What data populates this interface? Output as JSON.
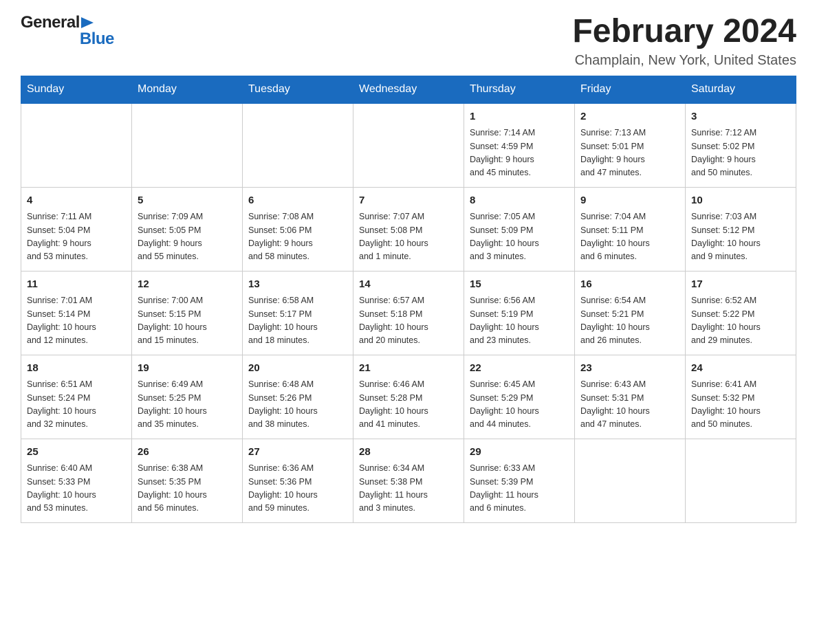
{
  "header": {
    "logo_general": "General",
    "logo_blue": "Blue",
    "month_title": "February 2024",
    "location": "Champlain, New York, United States"
  },
  "weekdays": [
    "Sunday",
    "Monday",
    "Tuesday",
    "Wednesday",
    "Thursday",
    "Friday",
    "Saturday"
  ],
  "weeks": [
    [
      {
        "day": "",
        "info": ""
      },
      {
        "day": "",
        "info": ""
      },
      {
        "day": "",
        "info": ""
      },
      {
        "day": "",
        "info": ""
      },
      {
        "day": "1",
        "info": "Sunrise: 7:14 AM\nSunset: 4:59 PM\nDaylight: 9 hours\nand 45 minutes."
      },
      {
        "day": "2",
        "info": "Sunrise: 7:13 AM\nSunset: 5:01 PM\nDaylight: 9 hours\nand 47 minutes."
      },
      {
        "day": "3",
        "info": "Sunrise: 7:12 AM\nSunset: 5:02 PM\nDaylight: 9 hours\nand 50 minutes."
      }
    ],
    [
      {
        "day": "4",
        "info": "Sunrise: 7:11 AM\nSunset: 5:04 PM\nDaylight: 9 hours\nand 53 minutes."
      },
      {
        "day": "5",
        "info": "Sunrise: 7:09 AM\nSunset: 5:05 PM\nDaylight: 9 hours\nand 55 minutes."
      },
      {
        "day": "6",
        "info": "Sunrise: 7:08 AM\nSunset: 5:06 PM\nDaylight: 9 hours\nand 58 minutes."
      },
      {
        "day": "7",
        "info": "Sunrise: 7:07 AM\nSunset: 5:08 PM\nDaylight: 10 hours\nand 1 minute."
      },
      {
        "day": "8",
        "info": "Sunrise: 7:05 AM\nSunset: 5:09 PM\nDaylight: 10 hours\nand 3 minutes."
      },
      {
        "day": "9",
        "info": "Sunrise: 7:04 AM\nSunset: 5:11 PM\nDaylight: 10 hours\nand 6 minutes."
      },
      {
        "day": "10",
        "info": "Sunrise: 7:03 AM\nSunset: 5:12 PM\nDaylight: 10 hours\nand 9 minutes."
      }
    ],
    [
      {
        "day": "11",
        "info": "Sunrise: 7:01 AM\nSunset: 5:14 PM\nDaylight: 10 hours\nand 12 minutes."
      },
      {
        "day": "12",
        "info": "Sunrise: 7:00 AM\nSunset: 5:15 PM\nDaylight: 10 hours\nand 15 minutes."
      },
      {
        "day": "13",
        "info": "Sunrise: 6:58 AM\nSunset: 5:17 PM\nDaylight: 10 hours\nand 18 minutes."
      },
      {
        "day": "14",
        "info": "Sunrise: 6:57 AM\nSunset: 5:18 PM\nDaylight: 10 hours\nand 20 minutes."
      },
      {
        "day": "15",
        "info": "Sunrise: 6:56 AM\nSunset: 5:19 PM\nDaylight: 10 hours\nand 23 minutes."
      },
      {
        "day": "16",
        "info": "Sunrise: 6:54 AM\nSunset: 5:21 PM\nDaylight: 10 hours\nand 26 minutes."
      },
      {
        "day": "17",
        "info": "Sunrise: 6:52 AM\nSunset: 5:22 PM\nDaylight: 10 hours\nand 29 minutes."
      }
    ],
    [
      {
        "day": "18",
        "info": "Sunrise: 6:51 AM\nSunset: 5:24 PM\nDaylight: 10 hours\nand 32 minutes."
      },
      {
        "day": "19",
        "info": "Sunrise: 6:49 AM\nSunset: 5:25 PM\nDaylight: 10 hours\nand 35 minutes."
      },
      {
        "day": "20",
        "info": "Sunrise: 6:48 AM\nSunset: 5:26 PM\nDaylight: 10 hours\nand 38 minutes."
      },
      {
        "day": "21",
        "info": "Sunrise: 6:46 AM\nSunset: 5:28 PM\nDaylight: 10 hours\nand 41 minutes."
      },
      {
        "day": "22",
        "info": "Sunrise: 6:45 AM\nSunset: 5:29 PM\nDaylight: 10 hours\nand 44 minutes."
      },
      {
        "day": "23",
        "info": "Sunrise: 6:43 AM\nSunset: 5:31 PM\nDaylight: 10 hours\nand 47 minutes."
      },
      {
        "day": "24",
        "info": "Sunrise: 6:41 AM\nSunset: 5:32 PM\nDaylight: 10 hours\nand 50 minutes."
      }
    ],
    [
      {
        "day": "25",
        "info": "Sunrise: 6:40 AM\nSunset: 5:33 PM\nDaylight: 10 hours\nand 53 minutes."
      },
      {
        "day": "26",
        "info": "Sunrise: 6:38 AM\nSunset: 5:35 PM\nDaylight: 10 hours\nand 56 minutes."
      },
      {
        "day": "27",
        "info": "Sunrise: 6:36 AM\nSunset: 5:36 PM\nDaylight: 10 hours\nand 59 minutes."
      },
      {
        "day": "28",
        "info": "Sunrise: 6:34 AM\nSunset: 5:38 PM\nDaylight: 11 hours\nand 3 minutes."
      },
      {
        "day": "29",
        "info": "Sunrise: 6:33 AM\nSunset: 5:39 PM\nDaylight: 11 hours\nand 6 minutes."
      },
      {
        "day": "",
        "info": ""
      },
      {
        "day": "",
        "info": ""
      }
    ]
  ]
}
